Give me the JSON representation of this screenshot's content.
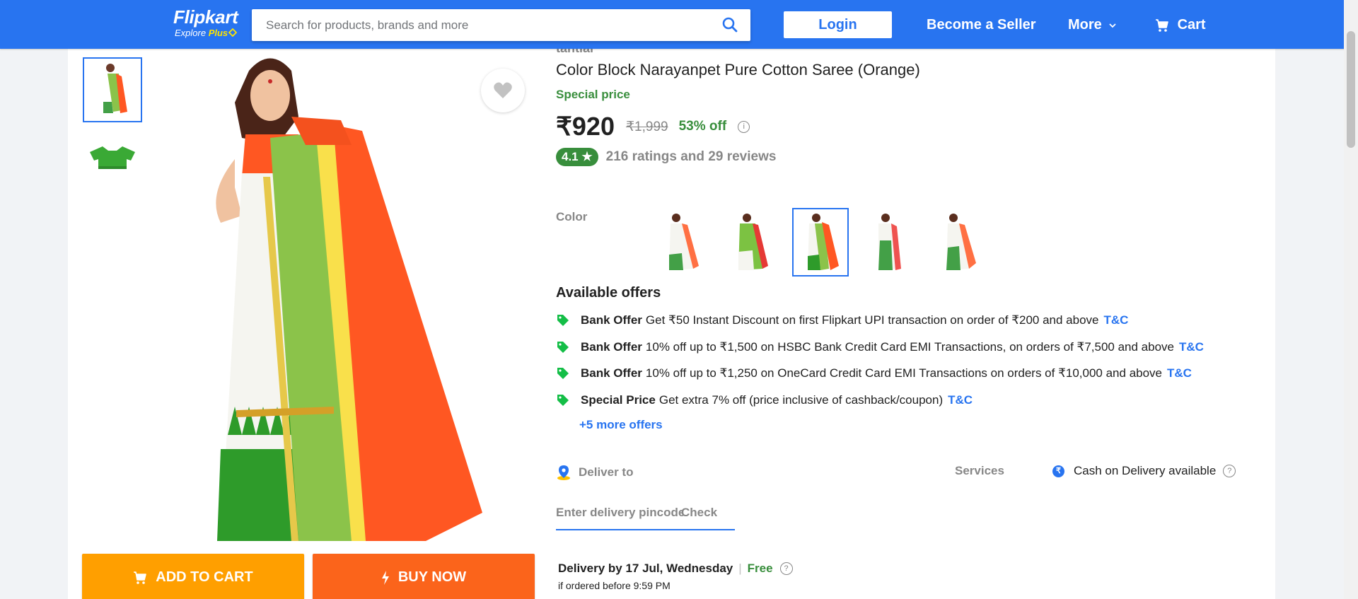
{
  "header": {
    "logo_name": "Flipkart",
    "logo_sub_prefix": "Explore ",
    "logo_sub_plus": "Plus",
    "search_placeholder": "Search for products, brands and more",
    "login_label": "Login",
    "seller_label": "Become a Seller",
    "more_label": "More",
    "cart_label": "Cart",
    "bg_color": "#2874f0"
  },
  "product": {
    "brand": "tantiar",
    "title": "Color Block Narayanpet Pure Cotton Saree  (Orange)",
    "special_label": "Special price",
    "price": "₹920",
    "mrp": "₹1,999",
    "discount": "53% off",
    "rating": "4.1",
    "ratings_text": "216 ratings and 29 reviews",
    "color_label": "Color",
    "selected_color_index": 2
  },
  "gallery": {
    "thumbnail_count": 2,
    "selected_index": 0
  },
  "buttons": {
    "add_to_cart": "ADD TO CART",
    "buy_now": "BUY NOW"
  },
  "offers": {
    "heading": "Available offers",
    "items": [
      {
        "type": "Bank Offer",
        "text": "Get ₹50 Instant Discount on first Flipkart UPI transaction on order of ₹200 and above",
        "link": "T&C"
      },
      {
        "type": "Bank Offer",
        "text": "10% off up to ₹1,500 on HSBC Bank Credit Card EMI Transactions, on orders of ₹7,500 and above",
        "link": "T&C"
      },
      {
        "type": "Bank Offer",
        "text": "10% off up to ₹1,250 on OneCard Credit Card EMI Transactions on orders of ₹10,000 and above",
        "link": "T&C"
      },
      {
        "type": "Special Price",
        "text": "Get extra 7% off (price inclusive of cashback/coupon)",
        "link": "T&C"
      }
    ],
    "more_link": "+5 more offers"
  },
  "delivery": {
    "deliver_to": "Deliver to",
    "pincode_placeholder": "Enter delivery pincode",
    "check_label": "Check",
    "services_label": "Services",
    "cod_text": "Cash on Delivery available",
    "delivery_date": "Delivery by 17 Jul, Wednesday",
    "separator": "|",
    "free_label": "Free",
    "order_before": "if ordered before 9:59 PM"
  },
  "colors": {
    "accent": "#2874f0",
    "green": "#388e3c",
    "orange_btn": "#ff9f00",
    "buy_btn": "#fb641b"
  }
}
